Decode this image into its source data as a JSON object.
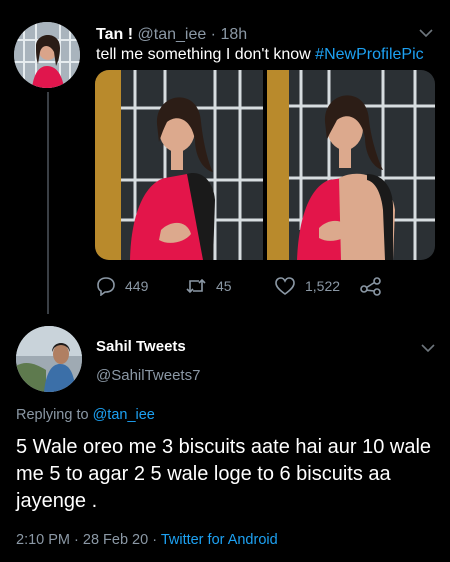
{
  "tweet1": {
    "name": "Tan",
    "badge": "!",
    "handle": "@tan_iee",
    "separator": " · ",
    "time": "18h",
    "text": "tell me something I don't know",
    "hashtag": "#NewProfilePic",
    "replies": "449",
    "retweets": "45",
    "likes": "1,522"
  },
  "tweet2": {
    "name": "Sahil Tweets",
    "handle": "@SahilTweets7",
    "replying_prefix": "Replying to ",
    "replying_to": "@tan_iee",
    "text": "5 Wale oreo me 3 biscuits aate hai aur 10 wale me 5 to agar 2 5 wale loge to 6 biscuits aa jayenge .",
    "timestamp": "2:10 PM · 28 Feb 20 · ",
    "source": "Twitter for Android"
  },
  "icons": [
    "chevron-down-icon",
    "reply-icon",
    "retweet-icon",
    "like-icon",
    "share-icon"
  ],
  "colors": {
    "background": "#000000",
    "link": "#1da1f2",
    "muted": "#8b98a5"
  }
}
